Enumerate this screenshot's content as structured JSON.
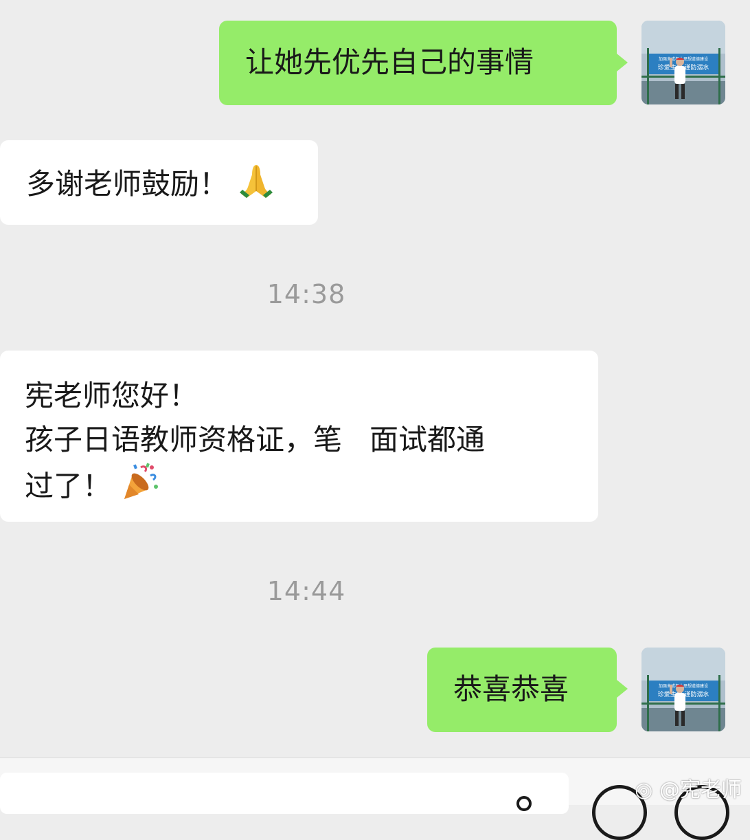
{
  "messages": [
    {
      "direction": "outgoing",
      "text": "让她先优先自己的事情"
    },
    {
      "direction": "incoming",
      "text": "多谢老师鼓励！",
      "emoji": "folded-hands"
    },
    {
      "direction": "incoming",
      "lines": [
        "宪老师您好！",
        "孩子日语教师资格证，笔   面试都通",
        "过了！"
      ],
      "emoji": "party-popper"
    },
    {
      "direction": "outgoing",
      "text": "恭喜恭喜"
    }
  ],
  "timestamps": [
    "14:38",
    "14:44"
  ],
  "avatar": {
    "sign_line1": "加强未成年人思想道德建设",
    "sign_line2": "珍爱生命 谨防溺水"
  },
  "watermark": "@宪老师",
  "colors": {
    "background": "#ededed",
    "outgoing_bubble": "#95ec69",
    "incoming_bubble": "#ffffff",
    "timestamp": "#9a9a9a"
  }
}
